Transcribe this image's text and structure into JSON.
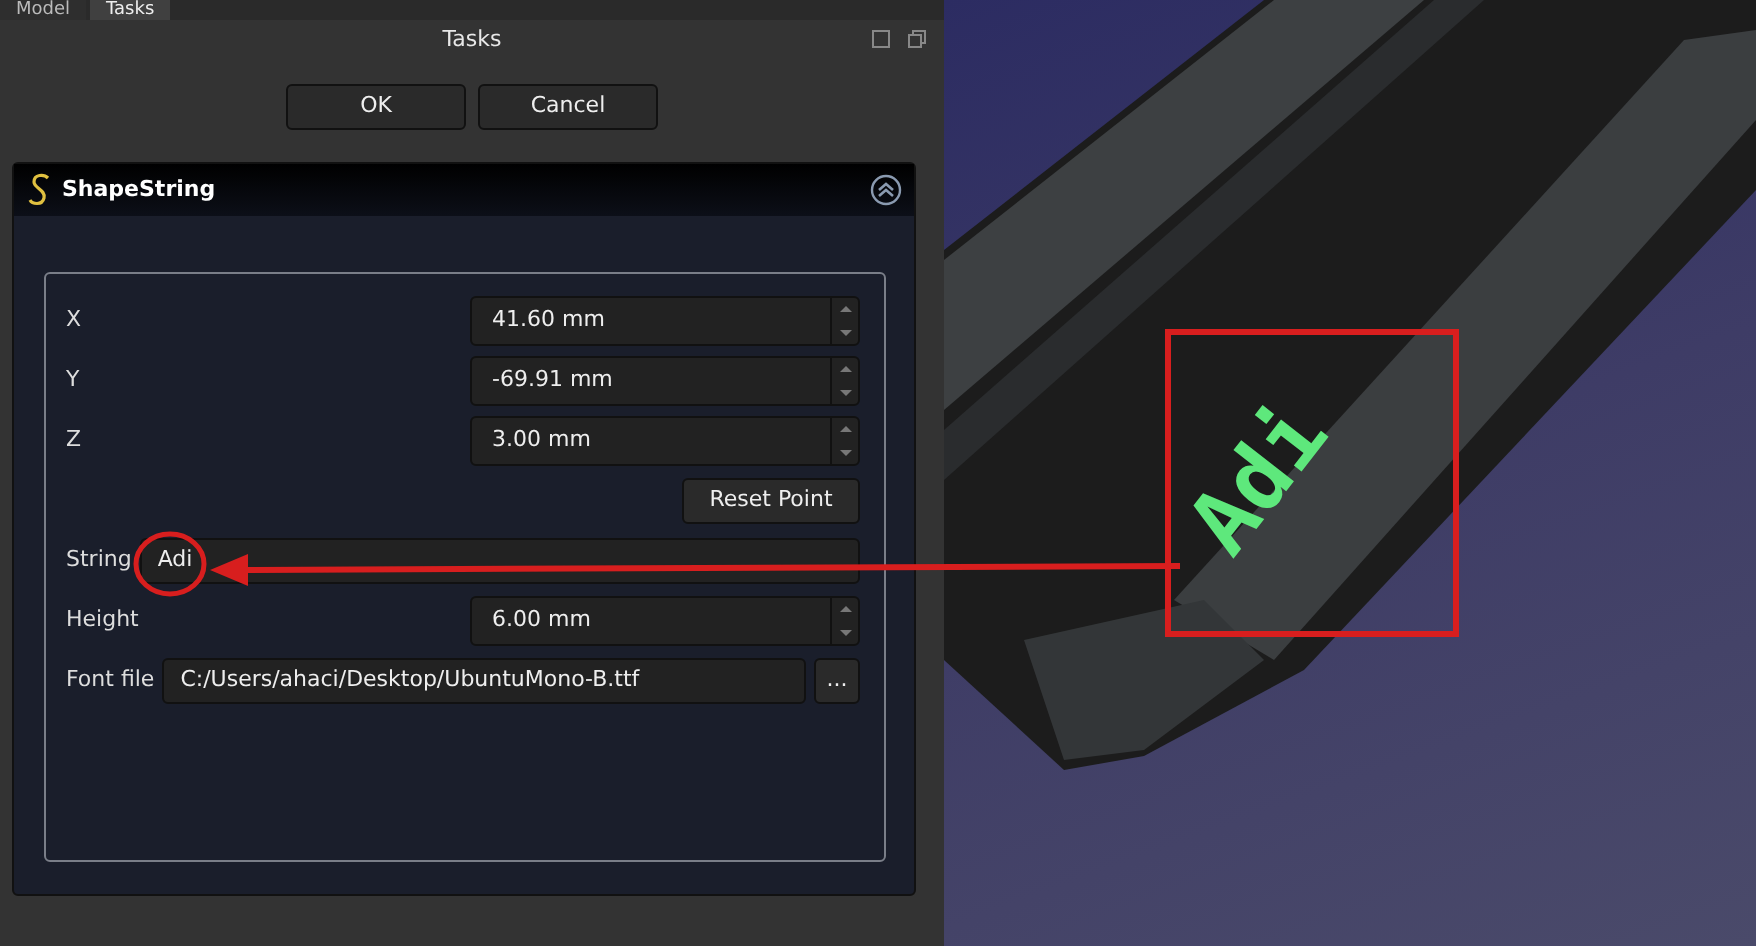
{
  "tabs": [
    {
      "label": "Model",
      "selected": false
    },
    {
      "label": "Tasks",
      "selected": true
    }
  ],
  "panel_title": "Tasks",
  "dialog_buttons": [
    "OK",
    "Cancel"
  ],
  "task_panel": {
    "title": "ShapeString",
    "expanded": true,
    "rows": [
      {
        "kind": "spin",
        "label": "X",
        "value": "41.60 mm"
      },
      {
        "kind": "spin",
        "label": "Y",
        "value": "-69.91 mm"
      },
      {
        "kind": "spin",
        "label": "Z",
        "value": "3.00 mm"
      },
      {
        "kind": "button",
        "label": "Reset Point"
      },
      {
        "kind": "text",
        "label": "String",
        "value": "Adi"
      },
      {
        "kind": "spin",
        "label": "Height",
        "value": "6.00 mm"
      },
      {
        "kind": "file",
        "label": "Font file",
        "value": "C:/Users/ahaci/Desktop/UbuntuMono-B.ttf",
        "button": "..."
      }
    ]
  },
  "viewport": {
    "model_text": "Adi"
  }
}
